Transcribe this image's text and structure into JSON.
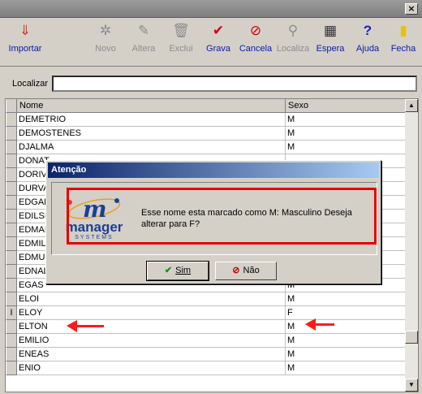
{
  "window": {
    "close_glyph": "×"
  },
  "toolbar": [
    {
      "label": "Importar",
      "icon": "import-icon",
      "glyph": "⇓",
      "enabled": true
    },
    {
      "label": "Novo",
      "icon": "new-icon",
      "glyph": "✲",
      "enabled": false
    },
    {
      "label": "Altera",
      "icon": "edit-icon",
      "glyph": "✎",
      "enabled": false
    },
    {
      "label": "Exclui",
      "icon": "trash-icon",
      "glyph": "🗑",
      "enabled": false
    },
    {
      "label": "Grava",
      "icon": "check-icon",
      "glyph": "✔",
      "enabled": true
    },
    {
      "label": "Cancela",
      "icon": "cancel-icon",
      "glyph": "⊘",
      "enabled": true
    },
    {
      "label": "Localiza",
      "icon": "binoculars-icon",
      "glyph": "⚲",
      "enabled": false
    },
    {
      "label": "Espera",
      "icon": "wait-icon",
      "glyph": "▦",
      "enabled": true
    },
    {
      "label": "Ajuda",
      "icon": "help-icon",
      "glyph": "?",
      "enabled": true
    },
    {
      "label": "Fecha",
      "icon": "exit-door-icon",
      "glyph": "▮",
      "enabled": true
    }
  ],
  "search": {
    "label": "Localizar",
    "value": ""
  },
  "grid": {
    "columns": [
      "Nome",
      "Sexo"
    ],
    "rows": [
      {
        "nome": "DEMETRIO",
        "sexo": "M"
      },
      {
        "nome": "DEMOSTENES",
        "sexo": "M"
      },
      {
        "nome": "DJALMA",
        "sexo": "M"
      },
      {
        "nome": "DONAT",
        "sexo": ""
      },
      {
        "nome": "DORIV",
        "sexo": ""
      },
      {
        "nome": "DURVA",
        "sexo": ""
      },
      {
        "nome": "EDGAR",
        "sexo": ""
      },
      {
        "nome": "EDILSI",
        "sexo": ""
      },
      {
        "nome": "EDMAI",
        "sexo": ""
      },
      {
        "nome": "EDMIL",
        "sexo": ""
      },
      {
        "nome": "EDMU",
        "sexo": ""
      },
      {
        "nome": "EDNALDO",
        "sexo": "M"
      },
      {
        "nome": "EGAS",
        "sexo": "M"
      },
      {
        "nome": "ELOI",
        "sexo": "M"
      },
      {
        "nome": "ELOY",
        "sexo": "F"
      },
      {
        "nome": "ELTON",
        "sexo": "M"
      },
      {
        "nome": "EMILIO",
        "sexo": "M"
      },
      {
        "nome": "ENEAS",
        "sexo": "M"
      },
      {
        "nome": "ENIO",
        "sexo": "M"
      }
    ],
    "current_row_marker": "I"
  },
  "dialog": {
    "title": "Atenção",
    "logo_text": "manager",
    "logo_subtext": "SYSTEMS",
    "message": "Esse nome esta marcado como M: Masculino Deseja alterar para F?",
    "yes_label": "Sim",
    "no_label": "Não"
  },
  "colors": {
    "highlight": "#e60000",
    "title_start": "#0a246a",
    "title_end": "#a6caf0",
    "link_blue": "#0a1aa8"
  }
}
